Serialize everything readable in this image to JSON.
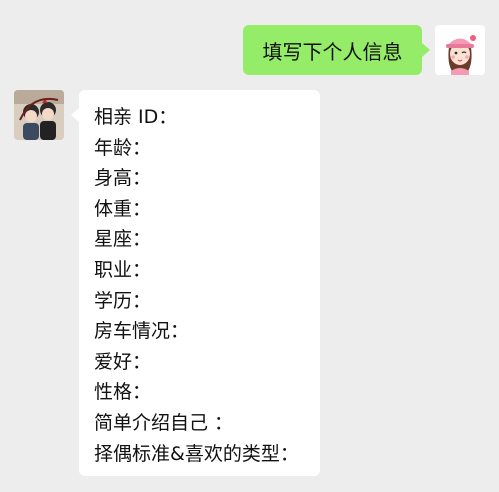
{
  "chat": {
    "outgoing": {
      "text": "填写下个人信息"
    },
    "incoming": {
      "lines": [
        "相亲 ID：",
        "年龄：",
        "身高：",
        "体重：",
        "星座：",
        "职业：",
        "学历：",
        "房车情况：",
        "爱好：",
        "性格：",
        "简单介绍自己 ：",
        "择偶标准&喜欢的类型："
      ]
    }
  },
  "colors": {
    "background": "#ededed",
    "outgoing_bubble": "#95ec69",
    "incoming_bubble": "#ffffff"
  },
  "icons": {
    "self_avatar": "girl-pink-cap-avatar",
    "contact_avatar": "cartoon-couple-avatar"
  }
}
